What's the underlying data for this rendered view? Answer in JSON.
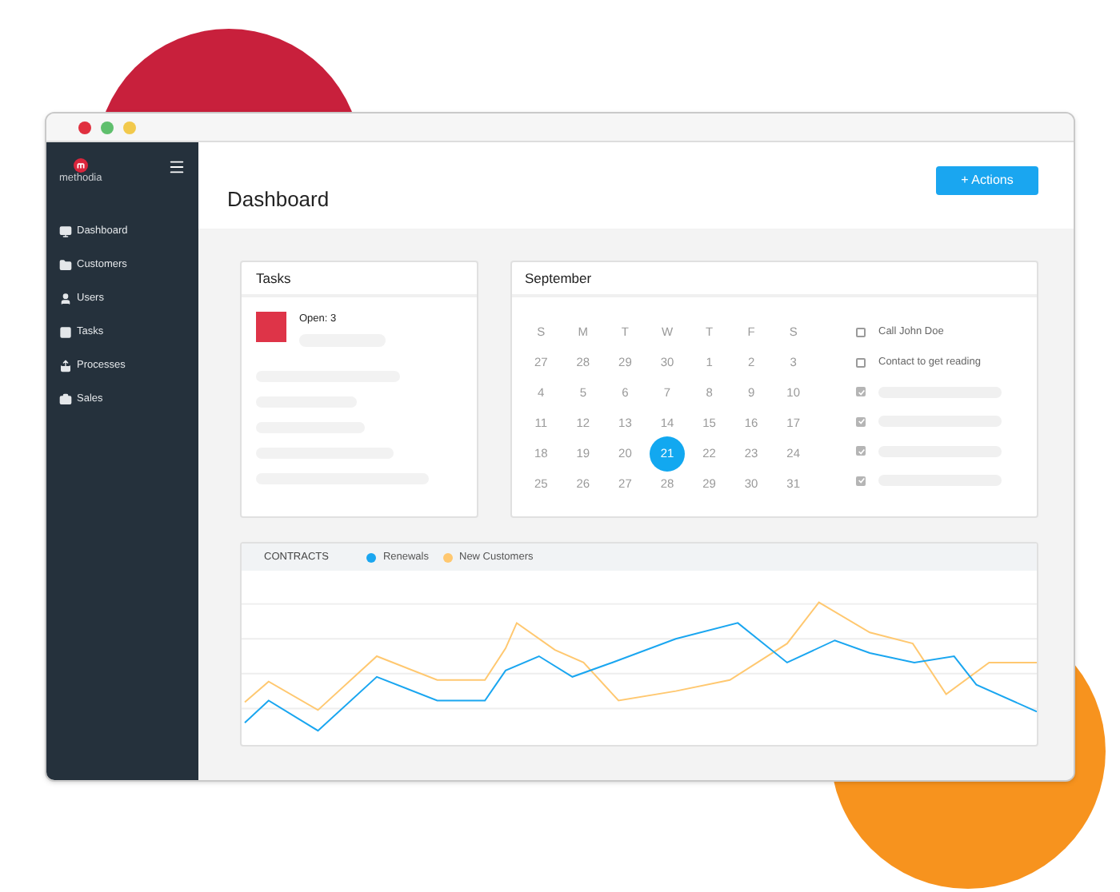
{
  "sidebar": {
    "logo": "methodia",
    "items": [
      {
        "label": "Dashboard",
        "selected": false
      },
      {
        "label": "Customers",
        "selected": false
      },
      {
        "label": "Users",
        "selected": false
      },
      {
        "label": "Tasks",
        "selected": false
      },
      {
        "label": "Processes",
        "selected": false
      },
      {
        "label": "Sales",
        "selected": false
      }
    ]
  },
  "header": {
    "title": "Dashboard",
    "action": "+ Actions"
  },
  "tasks": {
    "title": "Tasks",
    "open": "Open: 3"
  },
  "calendar": {
    "title": "September",
    "weekdays": [
      "S",
      "M",
      "T",
      "W",
      "T",
      "F",
      "S"
    ],
    "weeks": [
      [
        {
          "day": "27",
          "selected": false
        },
        {
          "day": "28",
          "selected": false
        },
        {
          "day": "29",
          "selected": false
        },
        {
          "day": "30",
          "selected": false
        },
        {
          "day": "1",
          "selected": false
        },
        {
          "day": "2",
          "selected": false
        },
        {
          "day": "3",
          "selected": false
        }
      ],
      [
        {
          "day": "4",
          "selected": false
        },
        {
          "day": "5",
          "selected": false
        },
        {
          "day": "6",
          "selected": false
        },
        {
          "day": "7",
          "selected": false
        },
        {
          "day": "8",
          "selected": false
        },
        {
          "day": "9",
          "selected": false
        },
        {
          "day": "10",
          "selected": false
        }
      ],
      [
        {
          "day": "11",
          "selected": false
        },
        {
          "day": "12",
          "selected": false
        },
        {
          "day": "13",
          "selected": false
        },
        {
          "day": "14",
          "selected": false
        },
        {
          "day": "15",
          "selected": false
        },
        {
          "day": "16",
          "selected": false
        },
        {
          "day": "17",
          "selected": false
        }
      ],
      [
        {
          "day": "18",
          "selected": false
        },
        {
          "day": "19",
          "selected": false
        },
        {
          "day": "20",
          "selected": false
        },
        {
          "day": "21",
          "selected": true
        },
        {
          "day": "22",
          "selected": false
        },
        {
          "day": "23",
          "selected": false
        },
        {
          "day": "24",
          "selected": false
        }
      ],
      [
        {
          "day": "25",
          "selected": false
        },
        {
          "day": "26",
          "selected": false
        },
        {
          "day": "27",
          "selected": false
        },
        {
          "day": "28",
          "selected": false
        },
        {
          "day": "29",
          "selected": false
        },
        {
          "day": "30",
          "selected": false
        },
        {
          "day": "31",
          "selected": false
        }
      ]
    ],
    "todos": [
      {
        "label": "Call John Doe",
        "checked": false
      },
      {
        "label": "Contact to get reading",
        "checked": false
      },
      {
        "checked": true
      },
      {
        "checked": true
      },
      {
        "checked": true
      },
      {
        "checked": true
      }
    ]
  },
  "contracts": {
    "title": "CONTRACTS",
    "legend": [
      {
        "label": "Renewals",
        "color": "#1aa6f0"
      },
      {
        "label": "New Customers",
        "color": "#ffc870"
      }
    ]
  }
}
